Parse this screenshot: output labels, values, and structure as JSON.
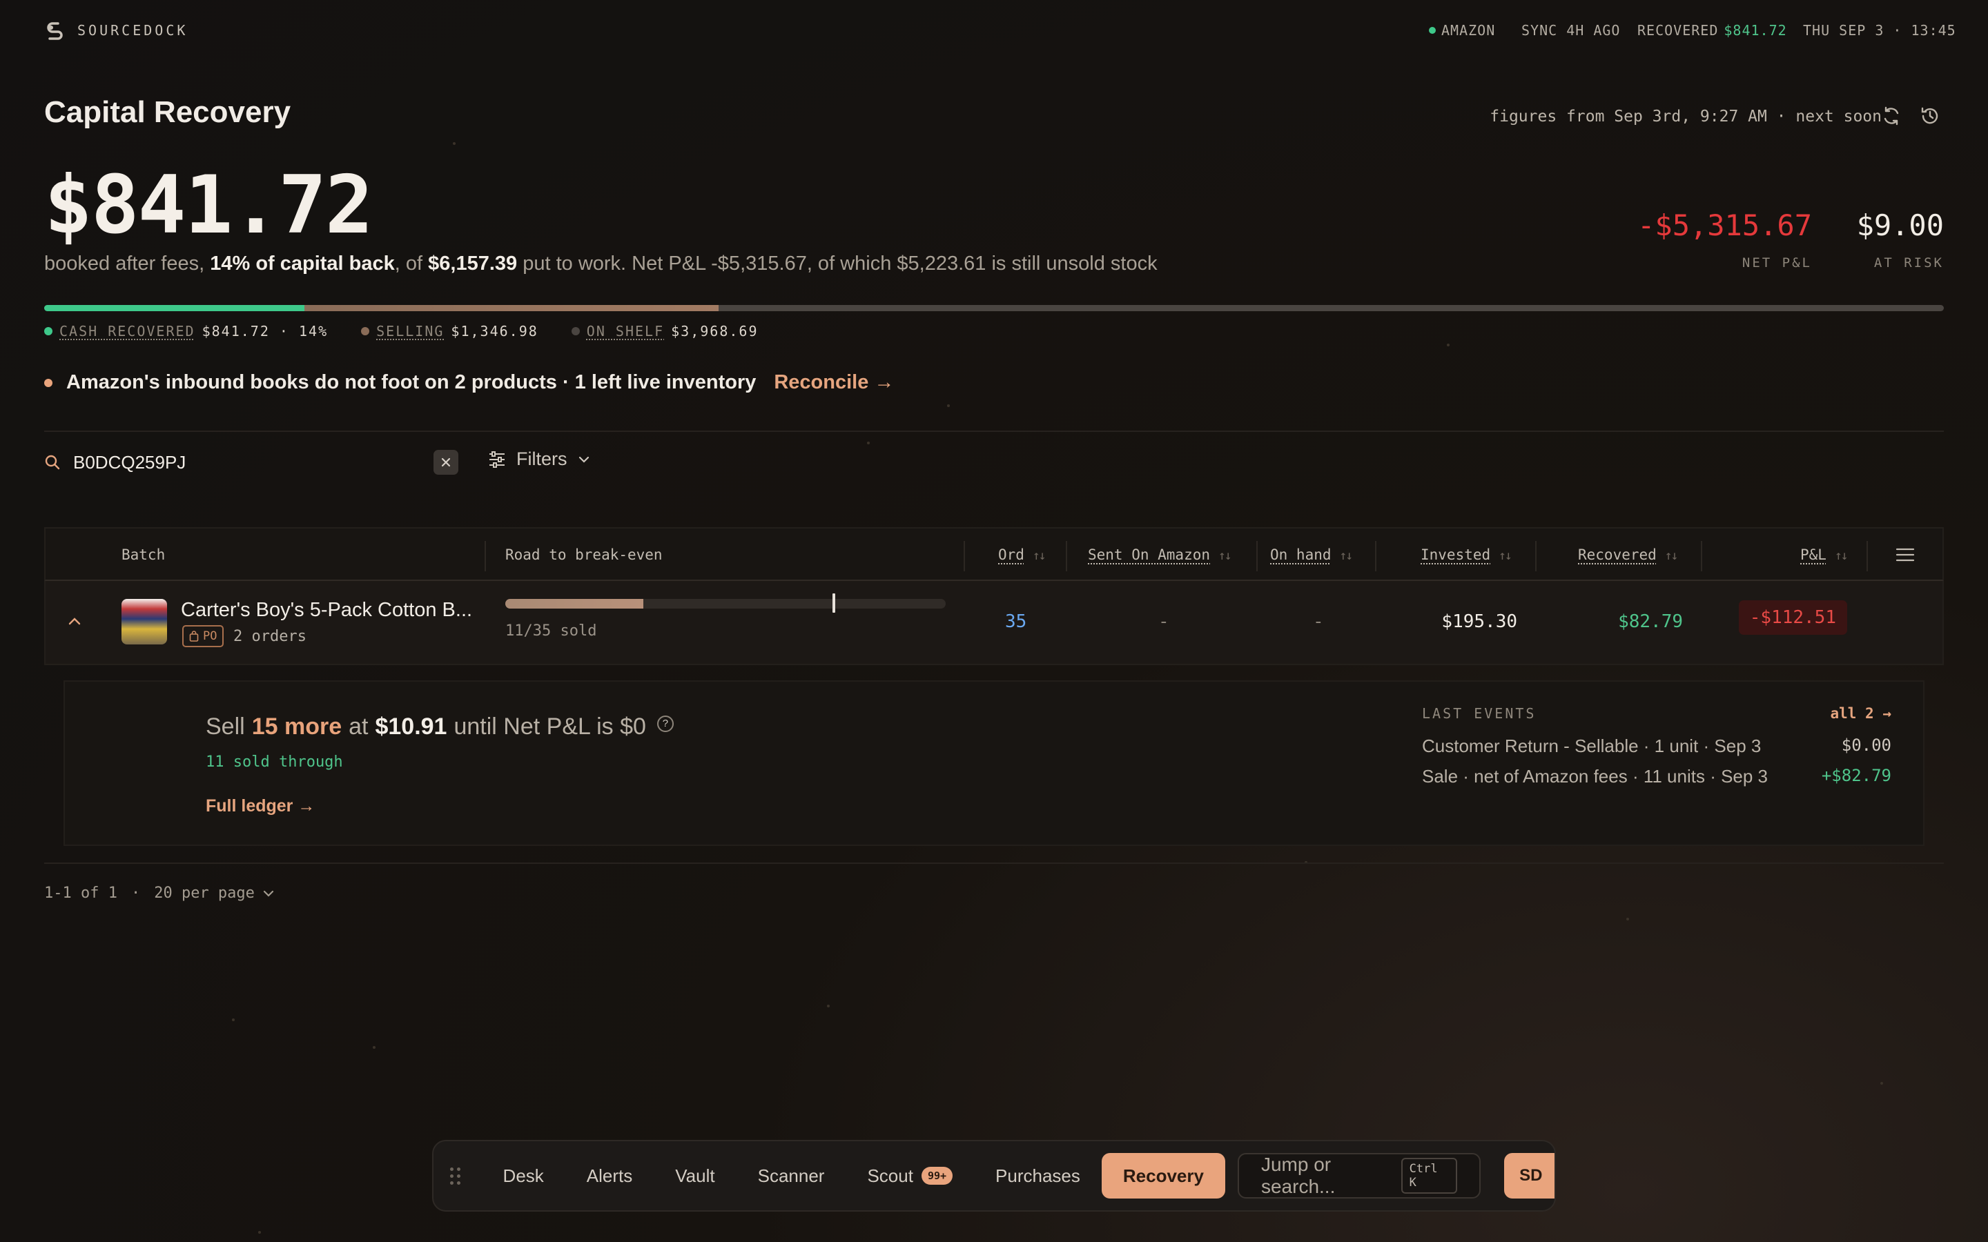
{
  "app": {
    "name": "SOURCEDOCK"
  },
  "topbar": {
    "marketplace": "AMAZON",
    "sync": "SYNC 4H AGO",
    "recovered_label": "RECOVERED",
    "recovered_value": "$841.72",
    "datetime": "THU SEP 3 · 13:45"
  },
  "header": {
    "title": "Capital Recovery",
    "figures_meta": "figures from Sep 3rd, 9:27 AM · next soon",
    "amount": "$841.72",
    "summary": {
      "p1": "booked after fees, ",
      "b1": "14% of capital back",
      "p2": ", of ",
      "b2": "$6,157.39",
      "p3": " put to work. Net P&L -$5,315.67, of which $5,223.61 is still unsold stock"
    },
    "net_pl": {
      "value": "-$5,315.67",
      "label": "NET P&L"
    },
    "at_risk": {
      "value": "$9.00",
      "label": "AT RISK"
    }
  },
  "progress": {
    "recovered_fraction": 0.137,
    "selling_fraction": 0.218,
    "shelf_fraction": 0.645,
    "legend": [
      {
        "label": "CASH RECOVERED",
        "value": "$841.72 · 14%",
        "color": "#3ec88a"
      },
      {
        "label": "SELLING",
        "value": "$1,346.98",
        "color": "#8a6c58"
      },
      {
        "label": "ON SHELF",
        "value": "$3,968.69",
        "color": "#4a4541"
      }
    ]
  },
  "alert": {
    "text": "Amazon's inbound books do not foot on 2 products · 1 left live inventory",
    "link": "Reconcile →"
  },
  "search": {
    "value": "B0DCQ259PJ",
    "filters_label": "Filters"
  },
  "table": {
    "columns": {
      "batch": "Batch",
      "road": "Road to break-even",
      "ord": "Ord",
      "sent": "Sent On Amazon",
      "onhand": "On hand",
      "invested": "Invested",
      "recovered": "Recovered",
      "pl": "P&L"
    },
    "rows": [
      {
        "name": "Carter's Boy's 5-Pack Cotton B...",
        "badge": "PO",
        "orders": "2 orders",
        "sold_fraction": 0.314,
        "breakeven_fraction": 0.743,
        "sold": "11/35 sold",
        "ord": "35",
        "sent": "-",
        "onhand": "-",
        "invested": "$195.30",
        "recovered": "$82.79",
        "pl": "-$112.51"
      }
    ],
    "expanded": {
      "sell_prefix": "Sell",
      "sell_more": "15 more",
      "sell_at": "at",
      "price": "$10.91",
      "sell_suffix": "until Net P&L is $0",
      "help": "?",
      "sold_through": "11 sold through",
      "ledger_link": "Full ledger →",
      "events_title": "LAST EVENTS",
      "events_all": "all 2 →",
      "events": [
        {
          "text": "Customer Return - Sellable · 1 unit · Sep 3",
          "amount": "$0.00"
        },
        {
          "text": "Sale · net of Amazon fees · 11 units · Sep 3",
          "amount": "+$82.79"
        }
      ]
    }
  },
  "pager": {
    "range": "1-1 of 1",
    "sep": "·",
    "per_page": "20 per page"
  },
  "dock": {
    "tabs": [
      "Desk",
      "Alerts",
      "Vault",
      "Scanner",
      "Scout",
      "Purchases",
      "Recovery"
    ],
    "scout_badge": "99+",
    "active": "Recovery",
    "jump_placeholder": "Jump or search...",
    "shortcut": "Ctrl K",
    "avatar": "SD"
  }
}
